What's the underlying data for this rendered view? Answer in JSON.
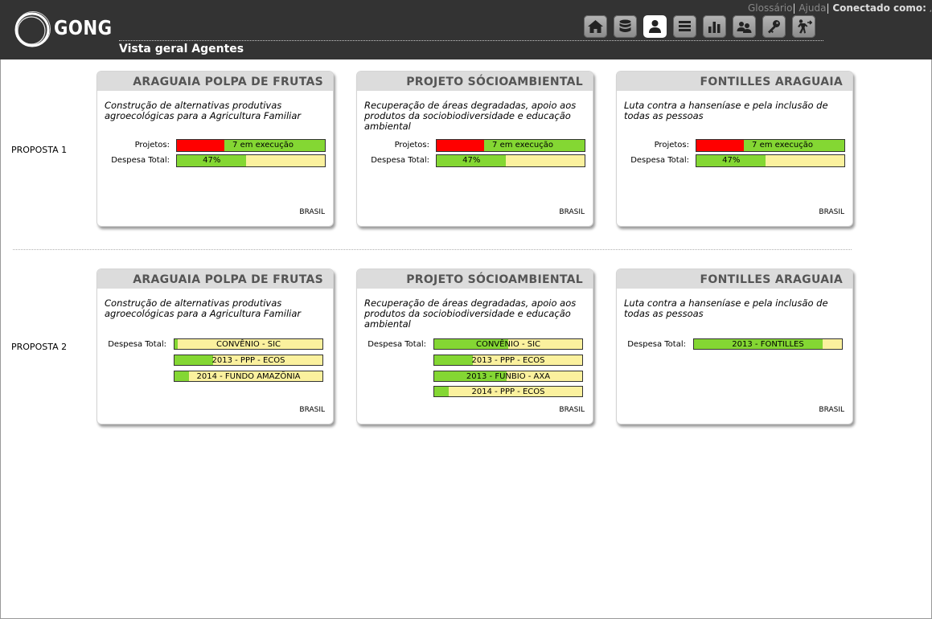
{
  "header": {
    "logo_text": "GONG",
    "page_title": "Vista geral Agentes",
    "links": {
      "glossary": "Glossário",
      "help": "Ajuda",
      "separator": "|",
      "connected": "Conectado como:",
      "user": ","
    },
    "nav_icons": [
      "home-icon",
      "database-icon",
      "agent-icon",
      "layers-icon",
      "bar-chart-icon",
      "users-icon",
      "key-icon",
      "logout-icon"
    ],
    "active_icon": "agent-icon"
  },
  "colors": {
    "header_bg": "#333333",
    "red": "#ff0000",
    "green": "#84d733",
    "yellow": "#fbf19e"
  },
  "labels": {
    "projects": "Projetos:",
    "total_expense": "Despesa Total:"
  },
  "proposta1": {
    "label": "PROPOSTA 1",
    "cards": [
      {
        "title": "ARAGUAIA POLPA DE FRUTAS",
        "description": "Construção de alternativas produtivas agroecológicas para a Agricultura Familiar",
        "projects_text": "7 em execução",
        "projects_red_fraction": 0.32,
        "expense_text": "47%",
        "expense_fraction": 0.47,
        "country": "BRASIL"
      },
      {
        "title": "PROJETO SÓCIOAMBIENTAL",
        "description": "Recuperação de áreas degradadas, apoio aos produtos da sociobiodiversidade e educação ambiental",
        "projects_text": "7 em execução",
        "projects_red_fraction": 0.32,
        "expense_text": "47%",
        "expense_fraction": 0.47,
        "country": "BRASIL"
      },
      {
        "title": "FONTILLES ARAGUAIA",
        "description": "Luta contra a hanseníase e pela inclusão de todas as pessoas",
        "projects_text": "7 em execução",
        "projects_red_fraction": 0.32,
        "expense_text": "47%",
        "expense_fraction": 0.47,
        "country": "BRASIL"
      }
    ]
  },
  "proposta2": {
    "label": "PROPOSTA 2",
    "cards": [
      {
        "title": "ARAGUAIA POLPA DE FRUTAS",
        "description": "Construção de alternativas produtivas agroecológicas para a Agricultura Familiar",
        "country": "BRASIL",
        "bars": [
          {
            "text": "CONVÊNIO - SIC",
            "fraction": 0.02
          },
          {
            "text": "2013 - PPP - ECOS",
            "fraction": 0.26
          },
          {
            "text": "2014 - FUNDO AMAZÔNIA",
            "fraction": 0.1
          }
        ]
      },
      {
        "title": "PROJETO SÓCIOAMBIENTAL",
        "description": "Recuperação de áreas degradadas, apoio aos produtos da sociobiodiversidade e educação ambiental",
        "country": "BRASIL",
        "bars": [
          {
            "text": "CONVÊNIO - SIC",
            "fraction": 0.5
          },
          {
            "text": "2013 - PPP - ECOS",
            "fraction": 0.26
          },
          {
            "text": "2013 - FUNBIO - AXA",
            "fraction": 0.49
          },
          {
            "text": "2014 - PPP - ECOS",
            "fraction": 0.1
          }
        ]
      },
      {
        "title": "FONTILLES ARAGUAIA",
        "description": "Luta contra a hanseníase e pela inclusão de todas as pessoas",
        "country": "BRASIL",
        "bars": [
          {
            "text": "2013 - FONTILLES",
            "fraction": 0.87
          }
        ]
      }
    ]
  }
}
